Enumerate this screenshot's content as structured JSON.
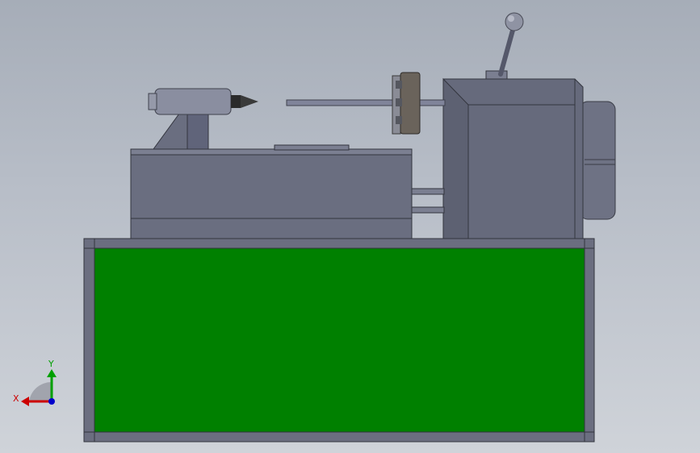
{
  "viewport": {
    "background_top": "#a6adb8",
    "background_bottom": "#cfd3d9"
  },
  "model": {
    "base_color": "#008000",
    "frame_color": "#6b6e80",
    "body_color": "#666a7c",
    "body_light": "#7b7f91",
    "chuck_color": "#6a635b",
    "tool_tip_color": "#2b2b2b"
  },
  "triad": {
    "x_label": "X",
    "y_label": "Y",
    "x_color": "#cc0000",
    "y_color": "#00a000",
    "z_color": "#0000cc"
  }
}
